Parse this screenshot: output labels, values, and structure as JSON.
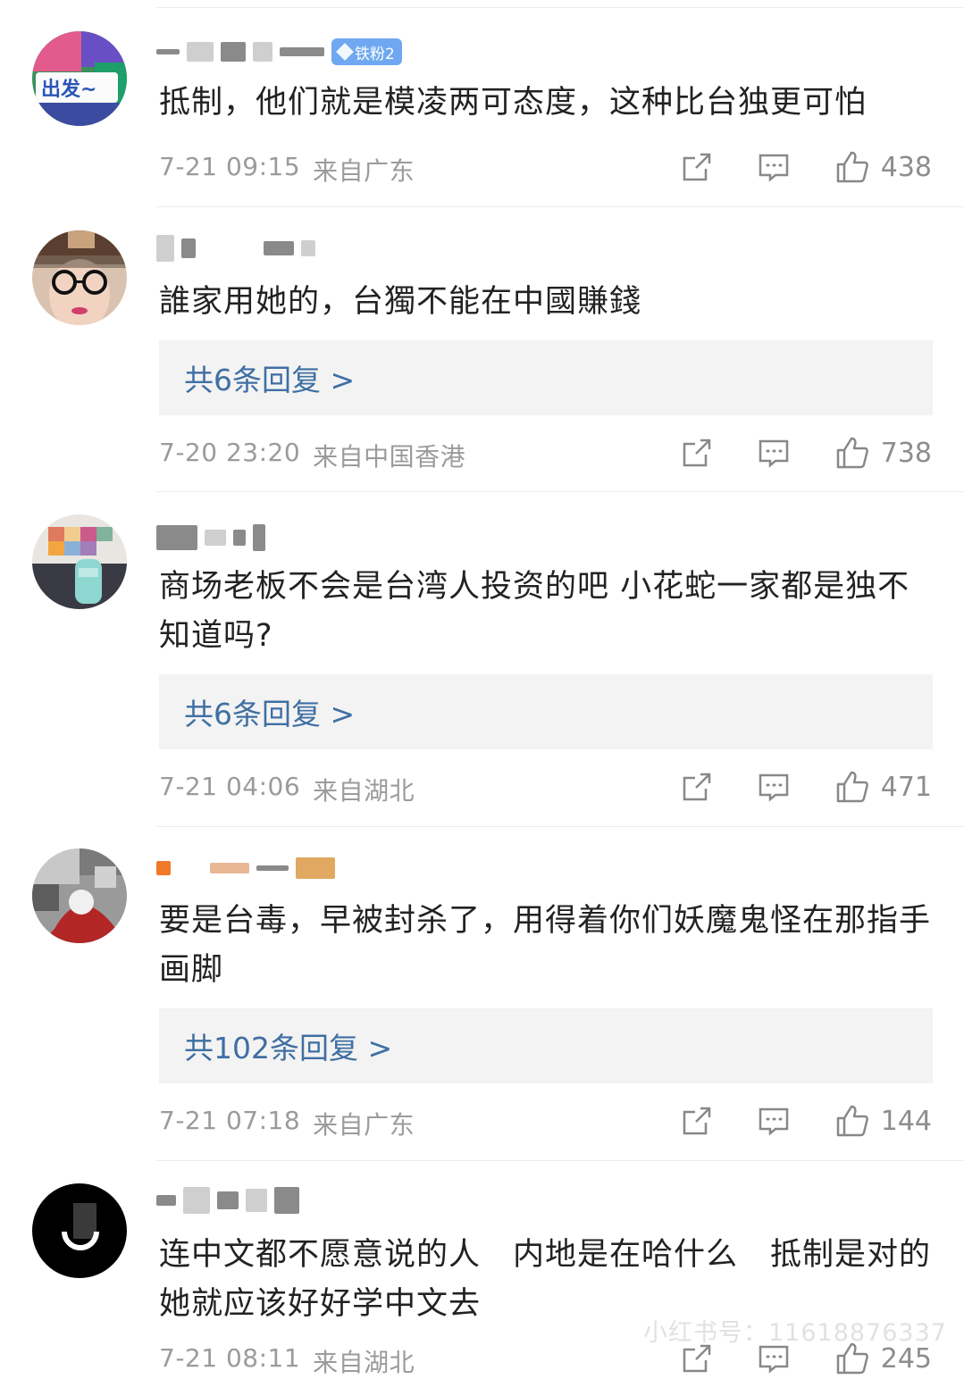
{
  "comments": [
    {
      "text": "抵制，他们就是模凌两可态度，这种比台独更可怕",
      "badge": "铁粉2",
      "date": "7-21 09:15",
      "location": "来自广东",
      "likes": "438",
      "avatar_label": "出发~"
    },
    {
      "text": "誰家用她的，台獨不能在中國賺錢",
      "replies": "共6条回复 >",
      "date": "7-20 23:20",
      "location": "来自中国香港",
      "likes": "738"
    },
    {
      "text": "商场老板不会是台湾人投资的吧 小花蛇一家都是独不知道吗?",
      "replies": "共6条回复 >",
      "date": "7-21 04:06",
      "location": "来自湖北",
      "likes": "471"
    },
    {
      "text": "要是台毒，早被封杀了，用得着你们妖魔鬼怪在那指手画脚",
      "replies": "共102条回复 >",
      "date": "7-21 07:18",
      "location": "来自广东",
      "likes": "144"
    },
    {
      "text": "连中文都不愿意说的人　内地是在哈什么　抵制是对的　她就应该好好学中文去",
      "date": "7-21 08:11",
      "location": "来自湖北",
      "likes": "245"
    }
  ],
  "watermark": "小红书号：11618876337",
  "colors": {
    "link": "#3f6fa3",
    "meta": "#9b9b9b",
    "reply_bg": "#f3f3f3",
    "badge": "#6fa8f0"
  },
  "icons": [
    "share-icon",
    "comment-icon",
    "like-icon"
  ]
}
